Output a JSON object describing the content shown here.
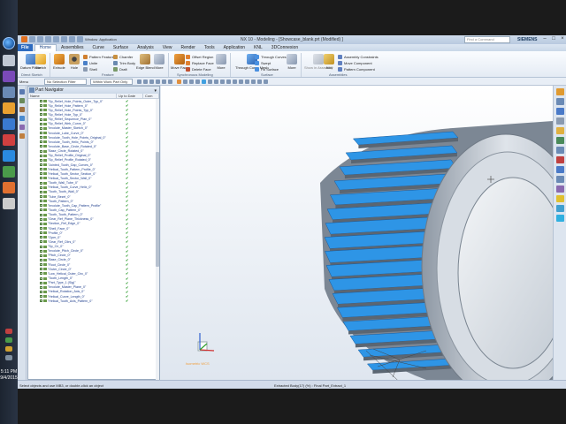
{
  "window": {
    "title": "NX 10 - Modeling - [Showcase_blank.prt (Modified) ]",
    "search_placeholder": "Find a Command",
    "brand": "SIEMENS"
  },
  "quick_access": {
    "window_label": "Window",
    "app_label": "Application"
  },
  "menu": {
    "file": "File",
    "tabs": [
      "Home",
      "Assemblies",
      "Curve",
      "Surface",
      "Analysis",
      "View",
      "Render",
      "Tools",
      "Application",
      "KNL",
      "3DConnexion"
    ],
    "active_index": 0
  },
  "ribbon": {
    "datum_plane": "Datum Plane",
    "sketch": "Sketch",
    "extrude": "Extrude",
    "hole": "Hole",
    "pattern_feature": "Pattern Feature",
    "unite": "Unite",
    "shell": "Shell",
    "chamfer": "Chamfer",
    "trim_body": "Trim Body",
    "draft": "Draft",
    "edge_blend": "Edge Blend",
    "more1": "More",
    "move_face": "Move Face",
    "offset_region": "Offset Region",
    "replace_face": "Replace Face",
    "delete_face": "Delete Face",
    "more2": "More",
    "through_curve_mesh": "Through Curve Mesh",
    "through_curves": "Through Curves",
    "swept": "Swept",
    "fill_surface": "Fill Surface",
    "more3": "More",
    "show_in_assembly": "Show in Assembly",
    "add": "Add",
    "assembly_constraints": "Assembly Constraints",
    "move_component": "Move Component",
    "pattern_component": "Pattern Component",
    "groups": [
      "Direct Sketch",
      "Feature",
      "Synchronous Modeling",
      "Surface",
      "Assemblies"
    ]
  },
  "selection_bar": {
    "menu_label": "Menu",
    "filter_value": "No Selection Filter",
    "scope_value": "Within Work Part Only"
  },
  "part_navigator": {
    "title": "Part Navigator",
    "columns": [
      "Name",
      "Up to Date",
      "Com"
    ],
    "rows": [
      "\"Sp_Relief_Hole_Points_Outer_Typ_0\"",
      "\"Sp_Relief_Hole_Pattern_0\"",
      "\"Sp_Relief_Hole_Points_Typ_0\"",
      "\"Sp_Relief_Hole_Typ_0\"",
      "\"Sp_Relief_Sequence_Plan_0\"",
      "\"Sp_Relief_Web_Curve_0\"",
      "\"Involute_Master_Sketch_0\"",
      "\"Involute_Lube_Curve_0\"",
      "\"Involute_Tooth_Hole_Points_Original_0\"",
      "\"Involute_Tooth_Helix_Points_0\"",
      "\"Involute_Base_Circle_Rotated_0\"",
      "\"Base_Circle_Rotated_0\"",
      "\"Sp_Relief_Profile_Original_0\"",
      "\"Sp_Relief_Profile_Rotated_0\"",
      "\"Jointed_Tooth_Gap_Curves_0\"",
      "\"Helical_Tooth_Pattern_Profile_0\"",
      "\"Helical_Tooth_Sector_Section_0\"",
      "\"Helical_Tooth_Sector_Wall_0\"",
      "\"Tooth_Wall_Tube_0\"",
      "\"Helical_Tooth_Curve_Helix_0\"",
      "\"Tooth_Tooth_Wall_0\"",
      "\"Tube_Bezel_0\"",
      "\"Tooth_Pattern_0\"",
      "\"Involute_Tooth_Cap_Pattern_Profile\"",
      "\"Tooth_Cap_Pattern_0\"",
      "\"Tooth_Tooth_Pattern_0\"",
      "\"Gear_Ref_Plane_Thickness_0\"",
      "\"Section_Ref_Edge_0\"",
      "\"Shell_Face_0\"",
      "\"Profile_0\"",
      "\"Oper_0\"",
      "\"Gear_Ref_Ctlrs_0\"",
      "\"Sp_Cir_0\"",
      "\"Involute_Pitch_Circle_0\"",
      "\"Pitch_Circle_0\"",
      "\"Base_Circle_0\"",
      "\"Root_Circle_0\"",
      "\"Outer_Circle_0\"",
      "\"Low_Helical_Outer_Circ_0\"",
      "\"Tooth_Length_0\"",
      "\"Part_Type_1 (Sig)\"",
      "\"Involute_Master_Plane_0\"",
      "\"Helical_Rotation_Axis_0\"",
      "\"Helical_Curve_Length_0\"",
      "\"Helical_Tooth_Axis_Pattern_0\""
    ]
  },
  "viewport": {
    "gear_blue": "#2e95e6",
    "gear_grey": "#c9d0d8",
    "watermark": "Isometric WCS"
  },
  "status": {
    "prompt": "Select objects and use MB3, or double-click an object",
    "info": "Extracted Body(17) (%) : Final Part_Extract_1"
  },
  "taskbar": {
    "time": "5:11 PM",
    "date": "9/4/2015"
  }
}
